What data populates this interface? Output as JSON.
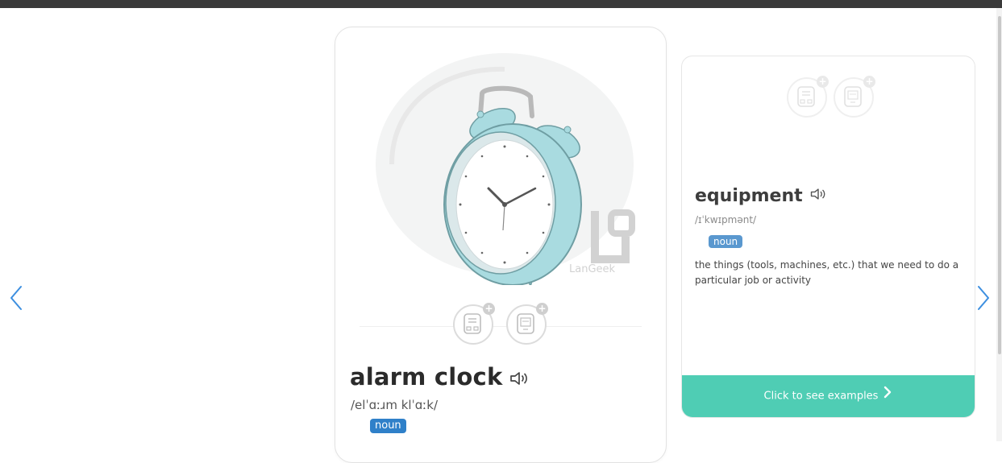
{
  "colors": {
    "accent_teal": "#4fcdb4",
    "badge_blue": "#2f80c9",
    "nav_blue": "#3d8fe0",
    "clock_teal": "#a9dbe0"
  },
  "icons": {
    "nav_prev": "chevron-left-icon",
    "nav_next": "chevron-right-icon",
    "speaker": "speaker-icon",
    "flashcard_add": "flashcard-add-icon",
    "flashcard_abc_add": "flashcard-abc-add-icon",
    "examples_chevron": "chevron-right-icon"
  },
  "main_card": {
    "word": "alarm clock",
    "pronunciation": "/elˈɑːɹm klˈɑːk/",
    "part_of_speech": "noun",
    "watermark": "LanGeek"
  },
  "side_card": {
    "word": "equipment",
    "pronunciation": "/ɪˈkwɪpmənt/",
    "part_of_speech": "noun",
    "definition": "the things (tools, machines, etc.) that we need to do a particular job or activity",
    "examples_button": "Click to see examples"
  }
}
